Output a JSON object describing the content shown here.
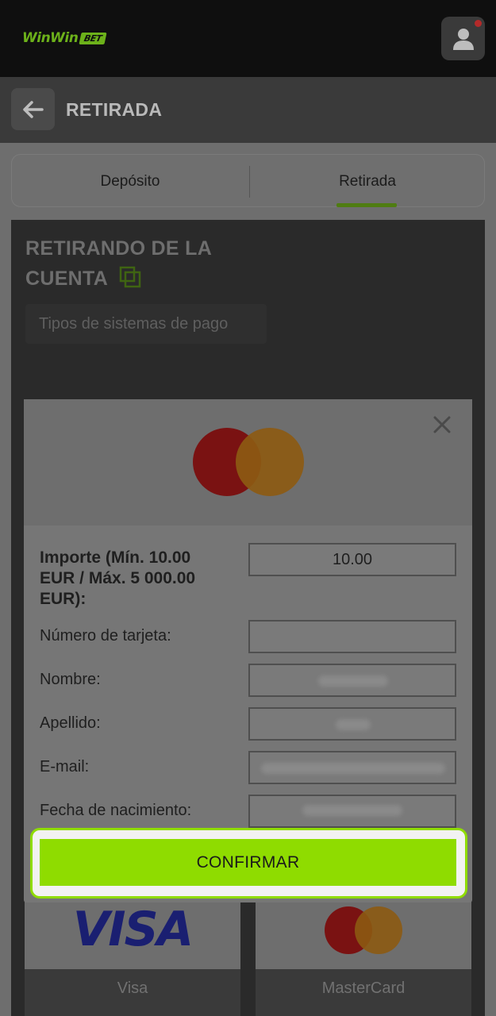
{
  "header": {
    "logo_text": "WinWin",
    "logo_badge": "BET",
    "brand_color": "#6cb11a",
    "profile_icon": "user-icon",
    "notification_dot_color": "#b32a2a"
  },
  "subheader": {
    "back_icon": "arrow-left-icon",
    "title": "RETIRADA"
  },
  "tabs": [
    {
      "label": "Depósito",
      "active": false
    },
    {
      "label": "Retirada",
      "active": true
    }
  ],
  "section": {
    "title": "RETIRANDO DE LA CUENTA",
    "copy_icon": "copy-icon",
    "payment_type_label": "Tipos de sistemas de pago"
  },
  "modal": {
    "close_icon": "close-icon",
    "logo": "mastercard-logo",
    "amount_label": "Importe (Mín. 10.00 EUR / Máx. 5 000.00 EUR):",
    "amount_value": "10.00",
    "fields": [
      {
        "label": "Número de tarjeta:",
        "value": ""
      },
      {
        "label": "Nombre:",
        "value": ""
      },
      {
        "label": "Apellido:",
        "value": ""
      },
      {
        "label": "E-mail:",
        "value": ""
      },
      {
        "label": "Fecha de nacimiento:",
        "value": ""
      }
    ],
    "confirm_label": "CONFIRMAR",
    "accent_color": "#8fdc00"
  },
  "methods": [
    {
      "label": "Visa",
      "logo_text": "VISA"
    },
    {
      "label": "MasterCard",
      "logo": "mastercard-logo"
    }
  ]
}
